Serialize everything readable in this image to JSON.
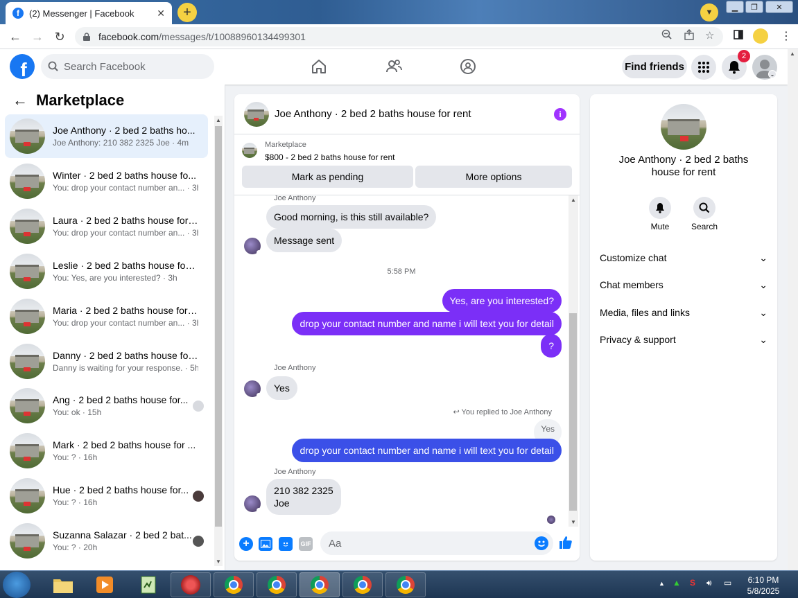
{
  "browser": {
    "tab_title": "(2) Messenger | Facebook",
    "url_host": "facebook.com",
    "url_path": "/messages/t/10088960134499301"
  },
  "header": {
    "search_placeholder": "Search Facebook",
    "find_friends": "Find friends",
    "notification_count": "2"
  },
  "sidebar": {
    "title": "Marketplace",
    "conversations": [
      {
        "name": "Joe Anthony · 2 bed 2 baths ho...",
        "preview": "Joe Anthony: 210 382 2325 Joe · 4m"
      },
      {
        "name": "Winter · 2 bed 2 baths house fo...",
        "preview": "You: drop your contact number an... · 3h"
      },
      {
        "name": "Laura · 2 bed 2 baths house for ...",
        "preview": "You: drop your contact number an... · 3h"
      },
      {
        "name": "Leslie · 2 bed 2 baths house for ...",
        "preview": "You: Yes, are you interested? · 3h"
      },
      {
        "name": "Maria · 2 bed 2 baths house for ...",
        "preview": "You: drop your contact number an... · 3h"
      },
      {
        "name": "Danny · 2 bed 2 baths house for...",
        "preview": "Danny is waiting for your response. · 5h"
      },
      {
        "name": "Ang · 2 bed 2 baths house for...",
        "preview": "You: ok · 15h"
      },
      {
        "name": "Mark · 2 bed 2 baths house for ...",
        "preview": "You: ? · 16h"
      },
      {
        "name": "Hue · 2 bed 2 baths house for...",
        "preview": "You: ? · 16h"
      },
      {
        "name": "Suzanna Salazar · 2 bed 2 bat...",
        "preview": "You: ? · 20h"
      }
    ]
  },
  "chat": {
    "title": "Joe Anthony · 2 bed 2 baths house for rent",
    "marketplace_label": "Marketplace",
    "listing": "$800 - 2 bed 2 baths house for rent",
    "mark_pending": "Mark as pending",
    "more_options": "More options",
    "sender_name": "Joe Anthony",
    "msg1": "Good morning, is this still available?",
    "msg2": "Message sent",
    "time": "5:58 PM",
    "out1": "Yes, are you interested?",
    "out2": "drop your contact number and name i will text you for detail",
    "out3": "?",
    "in3": "Yes",
    "reply_note": "You replied to Joe Anthony",
    "reply_quote": "Yes",
    "out4": "drop your contact number and name i will text you for detail",
    "in4_line1": "210 382 2325",
    "in4_line2": "Joe",
    "input_placeholder": "Aa",
    "gif_label": "GIF"
  },
  "info_panel": {
    "title": "Joe Anthony · 2 bed 2 baths house for rent",
    "mute": "Mute",
    "search": "Search",
    "rows": [
      "Customize chat",
      "Chat members",
      "Media, files and links",
      "Privacy & support"
    ]
  },
  "taskbar": {
    "time": "6:10 PM",
    "date": "5/8/2025"
  },
  "colors": {
    "facebook_blue": "#1877f2",
    "outgoing_purple": "#7b2ff7",
    "outgoing_blue": "#3b50e8",
    "selected_row": "#e6f0fc"
  }
}
